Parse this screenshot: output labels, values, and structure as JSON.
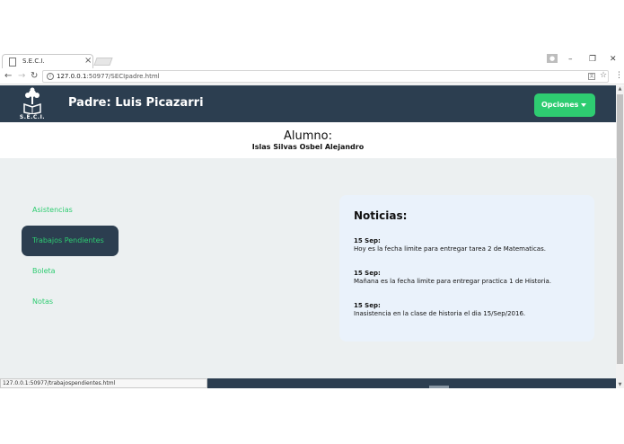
{
  "browser": {
    "tab_title": "S.E.C.I.",
    "url_host": "127.0.0.1",
    "url_path": ":50977/SECIpadre.html",
    "status_url": "127.0.0.1:50977/trabajospendientes.html"
  },
  "navbar": {
    "logo_text": "S.E.C.I.",
    "brand": "Padre: Luis Picazarri",
    "options_label": "Opciones"
  },
  "student": {
    "title": "Alumno:",
    "name": "Islas Silvas Osbel Alejandro"
  },
  "sidebar": {
    "items": [
      {
        "label": "Asistencias",
        "active": false
      },
      {
        "label": "Trabajos Pendientes",
        "active": true
      },
      {
        "label": "Boleta",
        "active": false
      },
      {
        "label": "Notas",
        "active": false
      }
    ]
  },
  "news": {
    "title": "Noticias:",
    "items": [
      {
        "date": "15 Sep:",
        "text": "Hoy es la fecha limite para entregar tarea 2 de Matematicas."
      },
      {
        "date": "15 Sep:",
        "text": "Mañana es la fecha limite para entregar practica 1 de Historia."
      },
      {
        "date": "15 Sep:",
        "text": "Inasistencia en la clase de historia el dia 15/Sep/2016."
      }
    ]
  },
  "colors": {
    "navbar": "#2c3e50",
    "accent_green": "#2ecc71",
    "page_background": "#ecf0f1",
    "news_panel": "#eaf2fb"
  },
  "icons": {
    "tab": "document-icon",
    "back": "back-arrow-icon",
    "forward": "forward-arrow-icon",
    "reload": "reload-icon",
    "info": "info-icon",
    "translate": "translate-icon",
    "bookmark": "star-icon",
    "menu": "kebab-menu-icon",
    "logo": "tree-book-logo-icon",
    "options_caret": "caret-down-icon"
  }
}
